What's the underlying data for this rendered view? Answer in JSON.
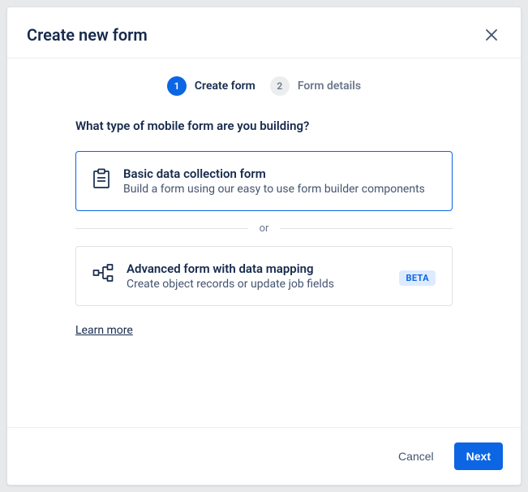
{
  "dialog": {
    "title": "Create new form"
  },
  "stepper": {
    "step1": {
      "num": "1",
      "label": "Create form"
    },
    "step2": {
      "num": "2",
      "label": "Form details"
    }
  },
  "question": "What type of mobile form are you building?",
  "option_basic": {
    "title": "Basic data collection form",
    "desc": "Build a form using our easy to use form builder components"
  },
  "or_label": "or",
  "option_advanced": {
    "title": "Advanced form with data mapping",
    "desc": "Create object records or update job fields",
    "badge": "BETA"
  },
  "learn_more": "Learn more",
  "footer": {
    "cancel": "Cancel",
    "next": "Next"
  }
}
